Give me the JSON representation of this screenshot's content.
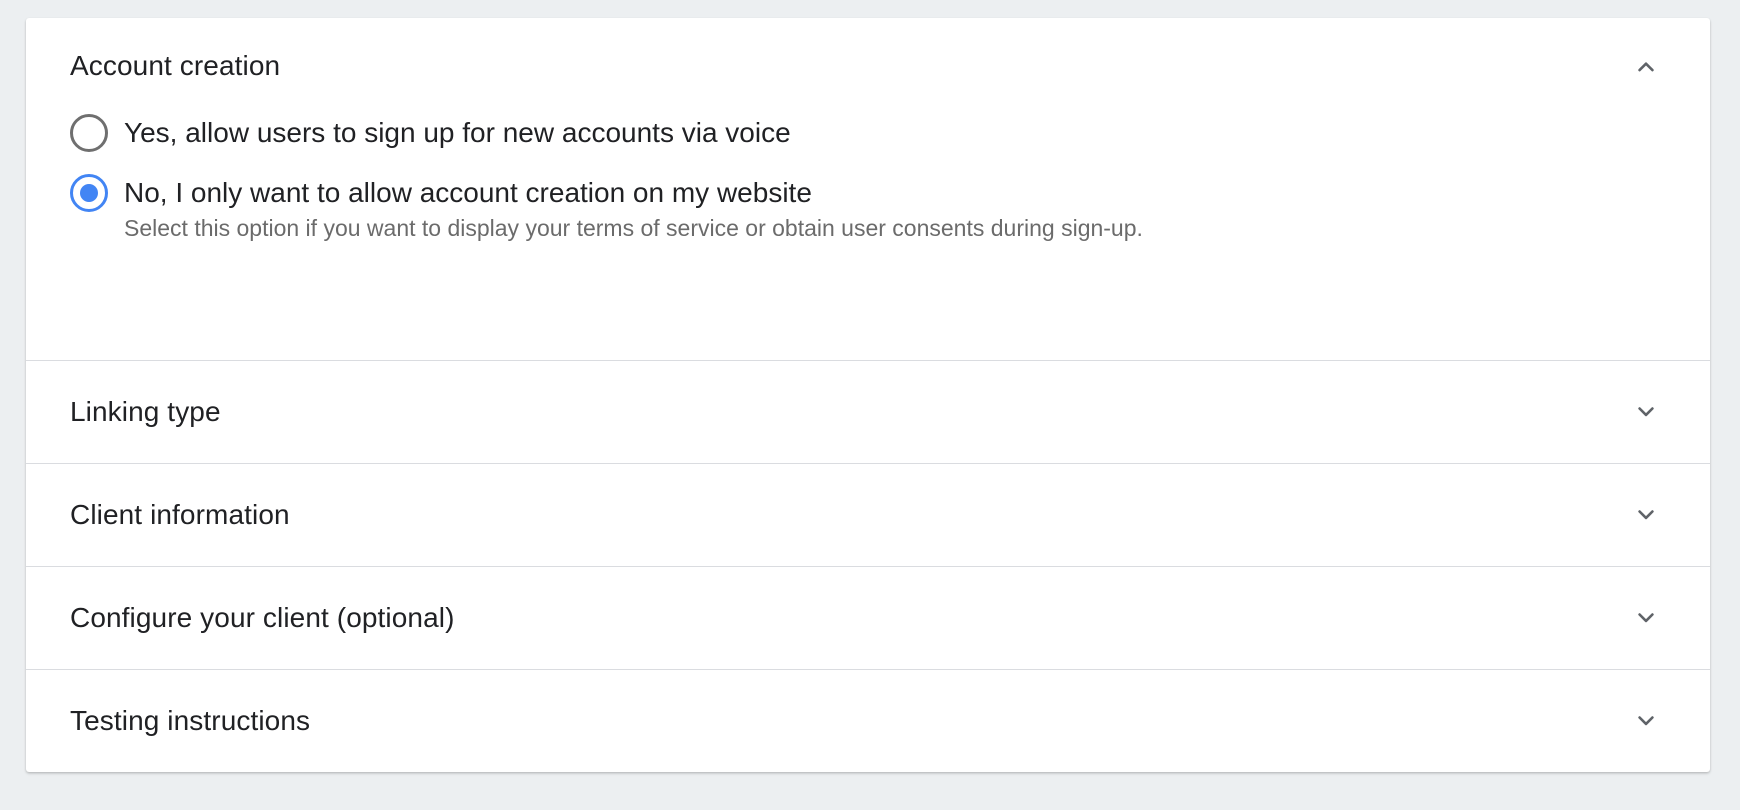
{
  "panels": [
    {
      "title": "Account creation",
      "expanded": true,
      "options": [
        {
          "label": "Yes, allow users to sign up for new accounts via voice",
          "checked": false
        },
        {
          "label": "No, I only want to allow account creation on my website",
          "hint": "Select this option if you want to display your terms of service or obtain user consents during sign-up.",
          "checked": true
        }
      ]
    },
    {
      "title": "Linking type",
      "expanded": false
    },
    {
      "title": "Client information",
      "expanded": false
    },
    {
      "title": "Configure your client (optional)",
      "expanded": false
    },
    {
      "title": "Testing instructions",
      "expanded": false
    }
  ],
  "colors": {
    "accent": "#4285f4",
    "background": "#eceff1",
    "divider": "#dadce0"
  },
  "icons": {
    "expanded": "chevron-up-icon",
    "collapsed": "chevron-down-icon"
  }
}
